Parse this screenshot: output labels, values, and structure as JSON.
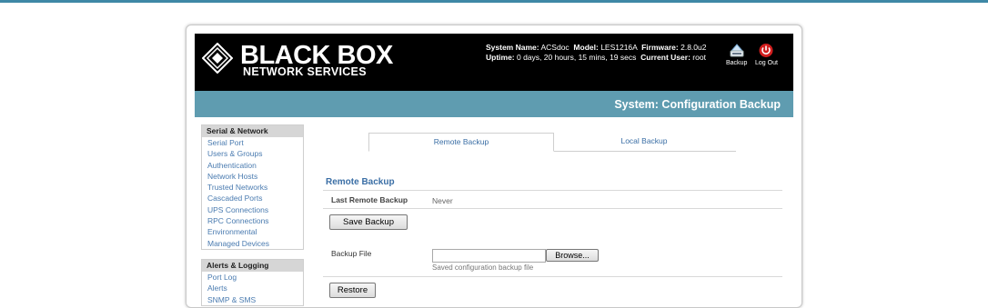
{
  "header": {
    "brand_main": "BLACK BOX",
    "brand_sub": "NETWORK SERVICES",
    "system_name_label": "System Name:",
    "system_name": "ACSdoc",
    "model_label": "Model:",
    "model": "LES1216A",
    "firmware_label": "Firmware:",
    "firmware": "2.8.0u2",
    "uptime_label": "Uptime:",
    "uptime": "0 days, 20 hours, 15 mins, 19 secs",
    "current_user_label": "Current User:",
    "current_user": "root",
    "backup_label": "Backup",
    "logout_label": "Log Out"
  },
  "page_title": "System: Configuration Backup",
  "sidebar": {
    "groups": [
      {
        "title": "Serial & Network",
        "items": [
          "Serial Port",
          "Users & Groups",
          "Authentication",
          "Network Hosts",
          "Trusted Networks",
          "Cascaded Ports",
          "UPS Connections",
          "RPC Connections",
          "Environmental",
          "Managed Devices"
        ]
      },
      {
        "title": "Alerts & Logging",
        "items": [
          "Port Log",
          "Alerts",
          "SNMP & SMS"
        ]
      }
    ]
  },
  "tabs": {
    "remote": "Remote Backup",
    "local": "Local Backup"
  },
  "remote_backup": {
    "section_title": "Remote Backup",
    "last_backup_label": "Last Remote Backup",
    "last_backup_value": "Never",
    "save_button": "Save Backup",
    "backup_file_label": "Backup File",
    "browse_button": "Browse...",
    "file_help": "Saved configuration backup file",
    "restore_button": "Restore"
  },
  "colors": {
    "header_bg": "#000000",
    "title_bar": "#5f9cb0",
    "link": "#4a7bb0",
    "top_line": "#3e88a6",
    "logout_red": "#d11e1e"
  }
}
